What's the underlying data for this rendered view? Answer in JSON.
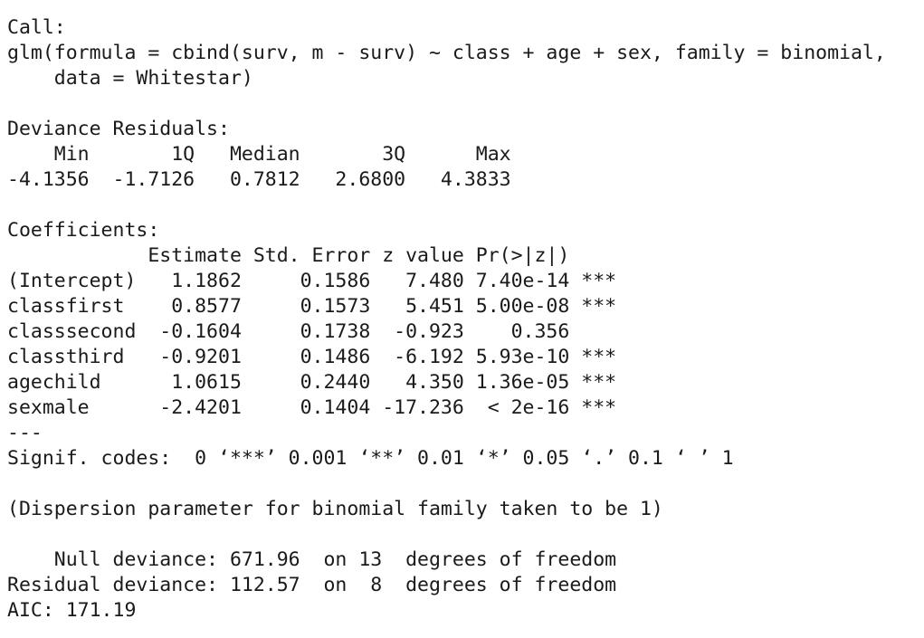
{
  "output": {
    "call_header": "Call:",
    "call_line1": "glm(formula = cbind(surv, m - surv) ~ class + age + sex, family = binomial,",
    "call_line2": "    data = Whitestar)",
    "blank1": "",
    "residuals_header": "Deviance Residuals:",
    "residuals_labels": "    Min       1Q   Median       3Q      Max  ",
    "residuals_values": "-4.1356  -1.7126   0.7812   2.6800   4.3833  ",
    "blank2": "",
    "coef_header": "Coefficients:",
    "coef_columns": "            Estimate Std. Error z value Pr(>|z|)    ",
    "coef_rows": [
      "(Intercept)   1.1862     0.1586   7.480 7.40e-14 ***",
      "classfirst    0.8577     0.1573   5.451 5.00e-08 ***",
      "classsecond  -0.1604     0.1738  -0.923    0.356    ",
      "classthird   -0.9201     0.1486  -6.192 5.93e-10 ***",
      "agechild      1.0615     0.2440   4.350 1.36e-05 ***",
      "sexmale      -2.4201     0.1404 -17.236  < 2e-16 ***"
    ],
    "separator": "---",
    "signif_codes": "Signif. codes:  0 ‘***’ 0.001 ‘**’ 0.01 ‘*’ 0.05 ‘.’ 0.1 ‘ ’ 1",
    "blank3": "",
    "dispersion": "(Dispersion parameter for binomial family taken to be 1)",
    "blank4": "",
    "null_deviance": "    Null deviance: 671.96  on 13  degrees of freedom",
    "residual_deviance": "Residual deviance: 112.57  on  8  degrees of freedom",
    "aic": "AIC: 171.19"
  }
}
